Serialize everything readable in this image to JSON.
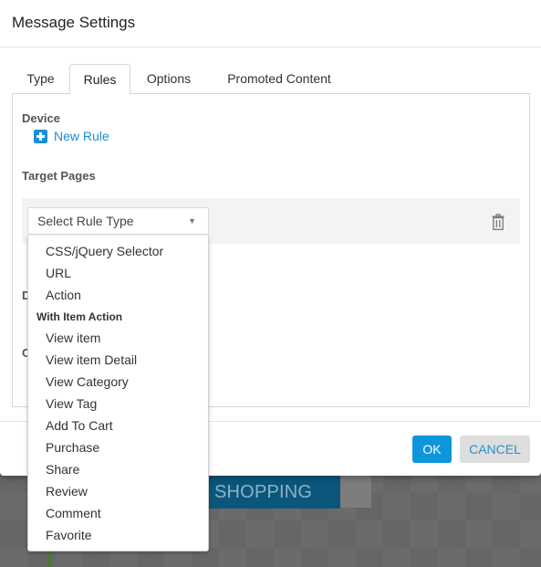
{
  "background": {
    "banner_text": "SHOPPING"
  },
  "modal": {
    "title": "Message Settings",
    "tabs": [
      {
        "label": "Type",
        "active": false
      },
      {
        "label": "Rules",
        "active": true
      },
      {
        "label": "Options",
        "active": false
      },
      {
        "label": "Promoted Content",
        "active": false
      }
    ],
    "sections": {
      "device_label": "Device",
      "new_rule_label": "New Rule",
      "target_pages_label": "Target Pages",
      "hidden_label_1": "D",
      "hidden_label_2": "C"
    },
    "rule_select": {
      "placeholder": "Select Rule Type",
      "arrow": "▼"
    },
    "dropdown": {
      "items": [
        {
          "type": "option",
          "label": "CSS/jQuery Selector"
        },
        {
          "type": "option",
          "label": "URL"
        },
        {
          "type": "option",
          "label": "Action"
        },
        {
          "type": "group",
          "label": "With Item Action"
        },
        {
          "type": "option",
          "label": "View item"
        },
        {
          "type": "option",
          "label": "View item Detail"
        },
        {
          "type": "option",
          "label": "View Category"
        },
        {
          "type": "option",
          "label": "View Tag"
        },
        {
          "type": "option",
          "label": "Add To Cart"
        },
        {
          "type": "option",
          "label": "Purchase"
        },
        {
          "type": "option",
          "label": "Share"
        },
        {
          "type": "option",
          "label": "Review"
        },
        {
          "type": "option",
          "label": "Comment"
        },
        {
          "type": "option",
          "label": "Favorite"
        }
      ]
    },
    "footer": {
      "ok_label": "OK",
      "cancel_label": "CANCEL"
    },
    "colors": {
      "accent": "#0e96dd",
      "link": "#1a8ed2"
    }
  }
}
